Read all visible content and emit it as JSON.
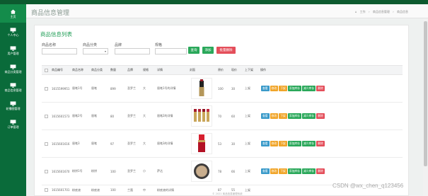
{
  "sidebar": {
    "items": [
      {
        "label": "主页",
        "icon": "home-icon"
      },
      {
        "label": "个人中心",
        "icon": "monitor-icon"
      },
      {
        "label": "用户管理",
        "icon": "monitor-icon"
      },
      {
        "label": "商品分类管理",
        "icon": "monitor-icon"
      },
      {
        "label": "商品信息管理",
        "icon": "monitor-icon"
      },
      {
        "label": "轮播图管理",
        "icon": "monitor-icon"
      },
      {
        "label": "订单管理",
        "icon": "monitor-icon"
      }
    ]
  },
  "header": {
    "title": "商品信息管理",
    "breadcrumb": [
      "工作",
      "商品信息管理",
      "商品信息"
    ]
  },
  "card": {
    "title": "商品信息列表"
  },
  "filters": {
    "name_label": "商品名称",
    "category_label": "商品分类",
    "brand_label": "品牌",
    "spec_label": "规格",
    "category_select": "▾",
    "search_btn": "查询",
    "add_btn": "添加",
    "batch_delete_btn": "批量删除"
  },
  "table": {
    "headers": [
      "商品编号",
      "商品名称",
      "商品分类",
      "数量",
      "品牌",
      "规格",
      "详情",
      "封面",
      "原价",
      "现价",
      "上下架",
      "操作"
    ],
    "rows": [
      {
        "code": "1615599951",
        "name": "眉笔1号",
        "category": "眉笔",
        "qty": "899",
        "brand": "圣罗兰",
        "spec": "大",
        "detail": "眉笔1号的详情",
        "price": "100",
        "now": "30",
        "status": "上架"
      },
      {
        "code": "1615601573",
        "name": "眉笔2号",
        "category": "眉笔",
        "qty": "80",
        "brand": "圣罗兰",
        "spec": "大",
        "detail": "眉笔2的详情",
        "price": "70",
        "now": "60",
        "status": "上架"
      },
      {
        "code": "1615601616",
        "name": "眉笔3",
        "category": "眉笔",
        "qty": "97",
        "brand": "圣罗兰",
        "spec": "大",
        "detail": "眉笔3的详情",
        "price": "53",
        "now": "30",
        "status": "上架"
      },
      {
        "code": "1615601670",
        "name": "粉饼1号",
        "category": "粉饼",
        "qty": "100",
        "brand": "圣罗兰",
        "spec": "小",
        "detail": "萨达",
        "price": "78",
        "now": "66",
        "status": "上架"
      },
      {
        "code": "1615601701",
        "name": "粉底液",
        "category": "粉底液",
        "qty": "100",
        "brand": "兰蔻",
        "spec": "中",
        "detail": "粉底液的详情",
        "price": "87",
        "now": "55",
        "status": "上架"
      }
    ],
    "ops": {
      "view": "查看",
      "edit": "修改",
      "down": "下架",
      "add_stock": "添加库存",
      "reduce_stock": "减少库存",
      "delete": "删除"
    }
  },
  "footer": {
    "text": "© 2021 商品信息管理系统"
  },
  "watermark": "CSDN @wx_chen_q123456",
  "colors": {
    "sidebar": "#0a6b3a",
    "accent": "#1f9d55",
    "danger": "#e44e5a",
    "warn": "#f0a52a",
    "info": "#3a9ac9"
  }
}
